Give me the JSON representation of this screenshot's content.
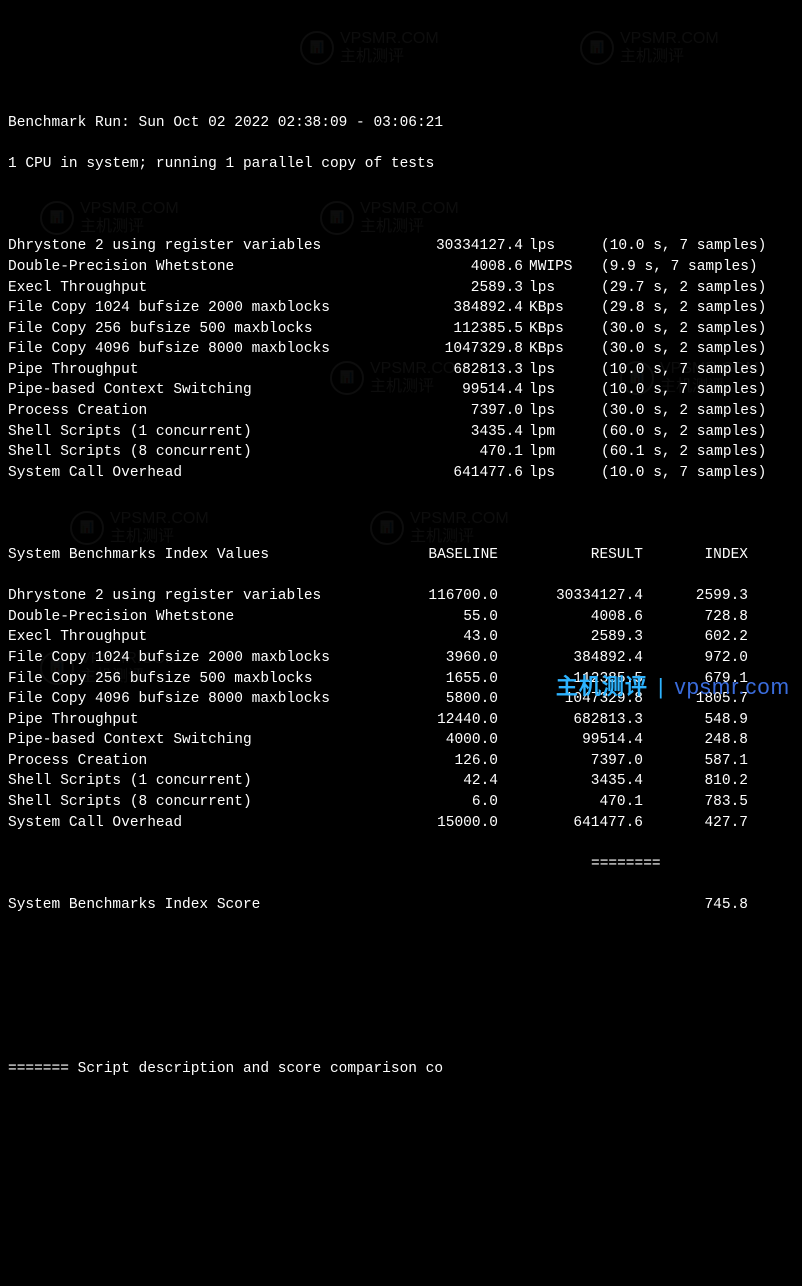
{
  "header": {
    "run": "Benchmark Run: Sun Oct 02 2022 02:38:09 - 03:06:21",
    "cpu": "1 CPU in system; running 1 parallel copy of tests"
  },
  "results": [
    {
      "name": "Dhrystone 2 using register variables",
      "value": "30334127.4",
      "unit": "lps",
      "timing": "(10.0 s, 7 samples)"
    },
    {
      "name": "Double-Precision Whetstone",
      "value": "4008.6",
      "unit": "MWIPS",
      "timing": "(9.9 s, 7 samples)"
    },
    {
      "name": "Execl Throughput",
      "value": "2589.3",
      "unit": "lps",
      "timing": "(29.7 s, 2 samples)"
    },
    {
      "name": "File Copy 1024 bufsize 2000 maxblocks",
      "value": "384892.4",
      "unit": "KBps",
      "timing": "(29.8 s, 2 samples)"
    },
    {
      "name": "File Copy 256 bufsize 500 maxblocks",
      "value": "112385.5",
      "unit": "KBps",
      "timing": "(30.0 s, 2 samples)"
    },
    {
      "name": "File Copy 4096 bufsize 8000 maxblocks",
      "value": "1047329.8",
      "unit": "KBps",
      "timing": "(30.0 s, 2 samples)"
    },
    {
      "name": "Pipe Throughput",
      "value": "682813.3",
      "unit": "lps",
      "timing": "(10.0 s, 7 samples)"
    },
    {
      "name": "Pipe-based Context Switching",
      "value": "99514.4",
      "unit": "lps",
      "timing": "(10.0 s, 7 samples)"
    },
    {
      "name": "Process Creation",
      "value": "7397.0",
      "unit": "lps",
      "timing": "(30.0 s, 2 samples)"
    },
    {
      "name": "Shell Scripts (1 concurrent)",
      "value": "3435.4",
      "unit": "lpm",
      "timing": "(60.0 s, 2 samples)"
    },
    {
      "name": "Shell Scripts (8 concurrent)",
      "value": "470.1",
      "unit": "lpm",
      "timing": "(60.1 s, 2 samples)"
    },
    {
      "name": "System Call Overhead",
      "value": "641477.6",
      "unit": "lps",
      "timing": "(10.0 s, 7 samples)"
    }
  ],
  "index_header": {
    "title": "System Benchmarks Index Values",
    "baseline": "BASELINE",
    "result": "RESULT",
    "index": "INDEX"
  },
  "index": [
    {
      "name": "Dhrystone 2 using register variables",
      "baseline": "116700.0",
      "result": "30334127.4",
      "index": "2599.3"
    },
    {
      "name": "Double-Precision Whetstone",
      "baseline": "55.0",
      "result": "4008.6",
      "index": "728.8"
    },
    {
      "name": "Execl Throughput",
      "baseline": "43.0",
      "result": "2589.3",
      "index": "602.2"
    },
    {
      "name": "File Copy 1024 bufsize 2000 maxblocks",
      "baseline": "3960.0",
      "result": "384892.4",
      "index": "972.0"
    },
    {
      "name": "File Copy 256 bufsize 500 maxblocks",
      "baseline": "1655.0",
      "result": "112385.5",
      "index": "679.1"
    },
    {
      "name": "File Copy 4096 bufsize 8000 maxblocks",
      "baseline": "5800.0",
      "result": "1047329.8",
      "index": "1805.7"
    },
    {
      "name": "Pipe Throughput",
      "baseline": "12440.0",
      "result": "682813.3",
      "index": "548.9"
    },
    {
      "name": "Pipe-based Context Switching",
      "baseline": "4000.0",
      "result": "99514.4",
      "index": "248.8"
    },
    {
      "name": "Process Creation",
      "baseline": "126.0",
      "result": "7397.0",
      "index": "587.1"
    },
    {
      "name": "Shell Scripts (1 concurrent)",
      "baseline": "42.4",
      "result": "3435.4",
      "index": "810.2"
    },
    {
      "name": "Shell Scripts (8 concurrent)",
      "baseline": "6.0",
      "result": "470.1",
      "index": "783.5"
    },
    {
      "name": "System Call Overhead",
      "baseline": "15000.0",
      "result": "641477.6",
      "index": "427.7"
    }
  ],
  "separator": "                                                                   ========",
  "score": {
    "name": "System Benchmarks Index Score",
    "value": "745.8"
  },
  "footer": "======= Script description and score comparison co",
  "credit": {
    "cn": "主机测评",
    "sep": "|",
    "url": "vpsmr.com"
  },
  "watermark": {
    "title": "主机测评",
    "url": "VPSMR.COM"
  }
}
